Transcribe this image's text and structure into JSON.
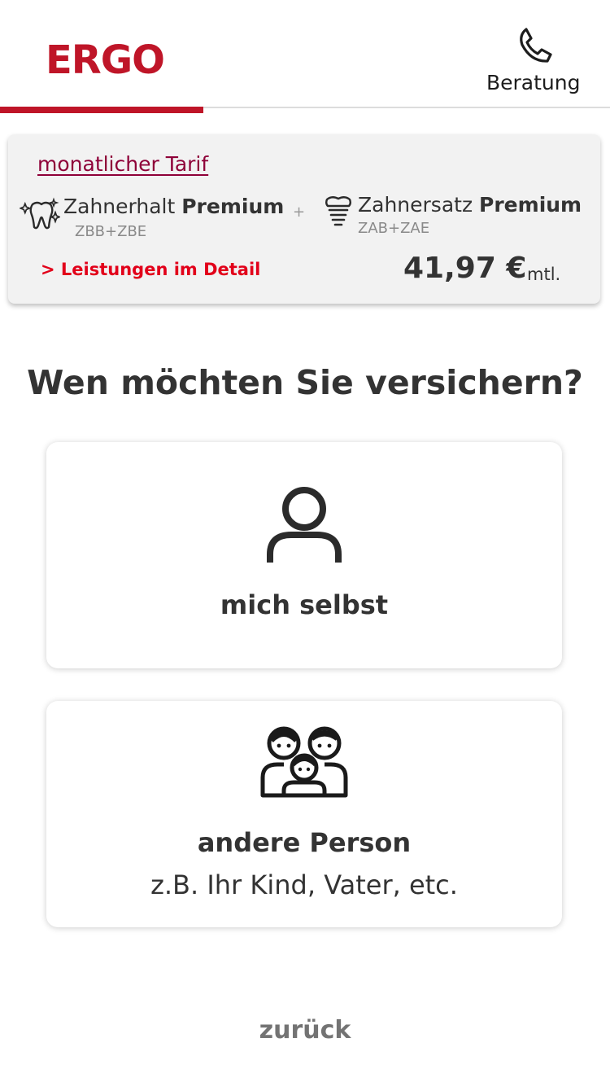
{
  "header": {
    "logo": "ERGO",
    "phone_icon": "phone-icon",
    "beratung_label": "Beratung",
    "progress_fraction": 0.333
  },
  "tariff": {
    "link_label": "monatlicher Tarif",
    "product1": {
      "icon": "sparkling-tooth-icon",
      "name_prefix": "Zahnerhalt",
      "name_strong": "Premium",
      "code": "ZBB+ZBE"
    },
    "plus": "+",
    "product2": {
      "icon": "dental-implant-icon",
      "name_prefix": "Zahnersatz",
      "name_strong": "Premium",
      "code": "ZAB+ZAE"
    },
    "detail_link": "> Leistungen im Detail",
    "price": "41,97 €",
    "price_unit": "mtl."
  },
  "question": "Wen möchten Sie versichern?",
  "options": [
    {
      "icon": "person-icon",
      "label": "mich selbst"
    },
    {
      "icon": "family-icon",
      "label": "andere Person",
      "sublabel": "z.B. Ihr Kind, Vater, etc."
    }
  ],
  "back_label": "zurück",
  "colors": {
    "brand_red": "#bf1528",
    "link_red": "#e2001a",
    "tarif_link": "#8e0038",
    "text": "#333333"
  }
}
